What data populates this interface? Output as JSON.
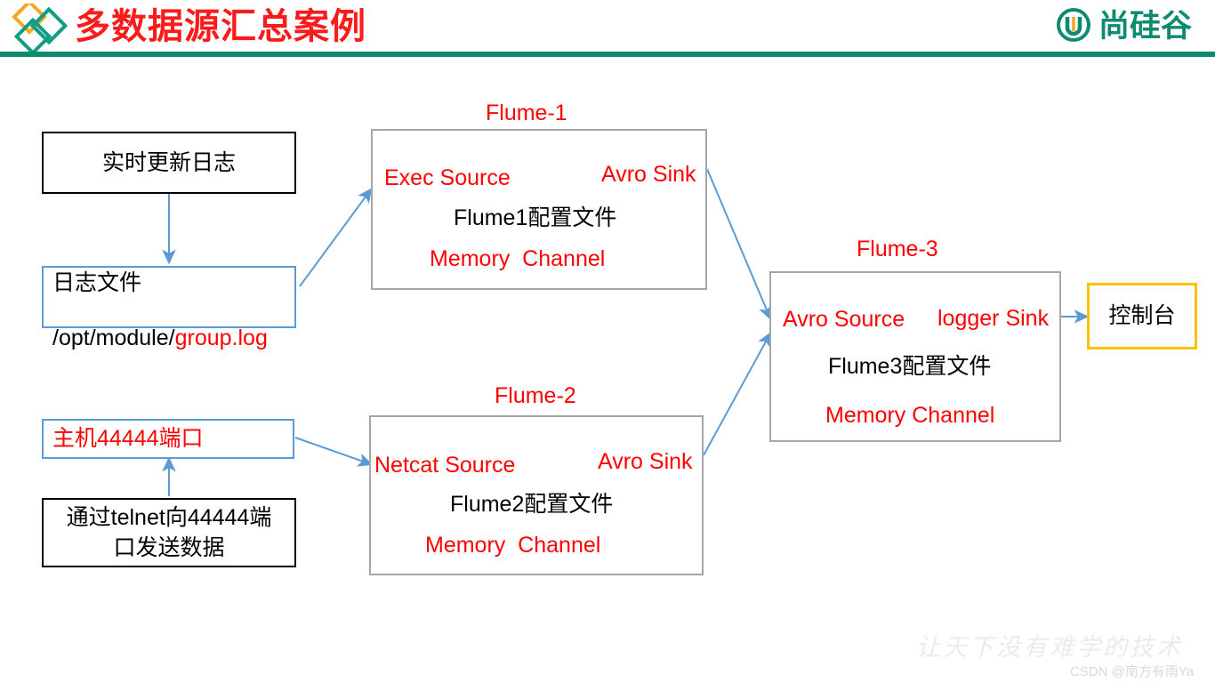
{
  "header": {
    "title": "多数据源汇总案例",
    "brand_name": "尚硅谷",
    "logo_icon": "diamond-triple-icon",
    "brand_icon": "u-circle-icon",
    "accent_green": "#0e8a6e",
    "accent_orange": "#f5a623",
    "title_color": "#fb1b1b"
  },
  "boxes": {
    "realtime_log": {
      "label": "实时更新日志",
      "border_color": "#000000",
      "text_color": "#000000"
    },
    "log_file": {
      "line1": "日志文件",
      "line2_prefix": "/opt/module/",
      "line2_highlight": "group.log",
      "border_color": "#5b9bd5",
      "highlight_color": "#ff0000"
    },
    "host_port": {
      "label": "主机44444端口",
      "border_color": "#5b9bd5",
      "text_color": "#ff0000"
    },
    "telnet_send": {
      "label": "通过telnet向44444端\n口发送数据",
      "border_color": "#000000",
      "text_color": "#000000"
    },
    "console": {
      "label": "控制台",
      "border_color": "#ffc000",
      "text_color": "#000000"
    }
  },
  "flumes": [
    {
      "title": "Flume-1",
      "source": "Exec Source",
      "sink": "Avro Sink",
      "channel": "Memory  Channel",
      "config": "Flume1配置文件",
      "border_color": "#a6a6a6",
      "text_color": "#ff0000"
    },
    {
      "title": "Flume-2",
      "source": "Netcat Source",
      "sink": "Avro Sink",
      "channel": "Memory  Channel",
      "config": "Flume2配置文件",
      "border_color": "#a6a6a6",
      "text_color": "#ff0000"
    },
    {
      "title": "Flume-3",
      "source": "Avro Source",
      "sink": "logger Sink",
      "channel": "Memory Channel",
      "config": "Flume3配置文件",
      "border_color": "#a6a6a6",
      "text_color": "#ff0000"
    }
  ],
  "arrows": {
    "connector_color": "#5b9bd5",
    "items": [
      {
        "name": "realtime-log-to-log-file",
        "style": "solid"
      },
      {
        "name": "log-file-to-flume1-source",
        "style": "solid"
      },
      {
        "name": "flume1-sink-to-flume3-source",
        "style": "solid"
      },
      {
        "name": "telnet-to-host-port",
        "style": "solid"
      },
      {
        "name": "host-port-to-flume2-source",
        "style": "solid"
      },
      {
        "name": "flume2-sink-to-flume3-source",
        "style": "solid"
      },
      {
        "name": "flume3-sink-to-console",
        "style": "solid"
      },
      {
        "name": "flume1-source-to-channel",
        "style": "dashed"
      },
      {
        "name": "flume1-channel-to-sink",
        "style": "dashed"
      },
      {
        "name": "flume2-source-to-channel",
        "style": "dashed"
      },
      {
        "name": "flume2-channel-to-sink",
        "style": "dashed"
      },
      {
        "name": "flume3-source-to-channel",
        "style": "dashed"
      },
      {
        "name": "flume3-channel-to-sink",
        "style": "dashed"
      }
    ]
  },
  "watermark": {
    "slogan": "让天下没有难学的技术",
    "credit": "CSDN @南方有雨Ya"
  }
}
